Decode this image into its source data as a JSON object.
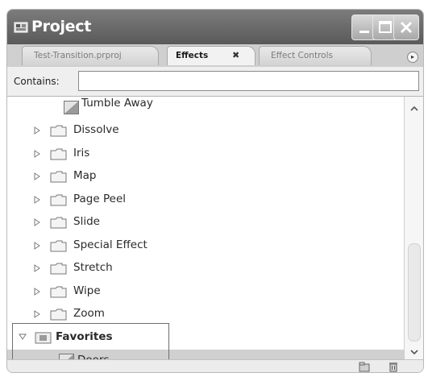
{
  "window": {
    "title": "Project",
    "icon": "project-panel-icon",
    "buttons": [
      "minimize-icon",
      "maximize-icon",
      "close-icon"
    ]
  },
  "tabs": [
    {
      "label": "Test-Transition.prproj",
      "active": false
    },
    {
      "label": "Effects",
      "active": true,
      "close_glyph": "✖"
    },
    {
      "label": "Effect Controls",
      "active": false
    }
  ],
  "panel_menu_glyph": "▸",
  "search": {
    "label": "Contains:",
    "value": ""
  },
  "tree": {
    "first_item": {
      "label": "Tumble Away",
      "icon": "transition-effect-icon"
    },
    "folders": [
      {
        "label": "Dissolve"
      },
      {
        "label": "Iris"
      },
      {
        "label": "Map"
      },
      {
        "label": "Page Peel"
      },
      {
        "label": "Slide"
      },
      {
        "label": "Special Effect"
      },
      {
        "label": "Stretch"
      },
      {
        "label": "Wipe"
      },
      {
        "label": "Zoom"
      }
    ],
    "favorites": {
      "label": "Favorites",
      "expanded": true,
      "icon": "favorites-folder-icon"
    },
    "favorite_items": [
      {
        "label": "Doors",
        "selected": true,
        "icon": "transition-effect-icon"
      }
    ]
  },
  "footer": {
    "buttons": [
      "new-custom-bin-icon",
      "delete-icon"
    ]
  },
  "colors": {
    "titlebar": "#6b6b6b",
    "selection": "#d0d0d0"
  }
}
